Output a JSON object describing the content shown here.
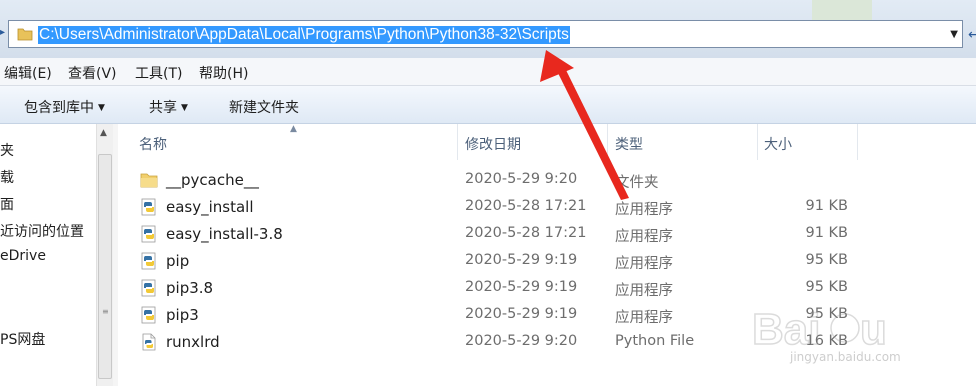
{
  "address": {
    "path": "C:\\Users\\Administrator\\AppData\\Local\\Programs\\Python\\Python38-32\\Scripts"
  },
  "menu": [
    {
      "label": "编辑(E)"
    },
    {
      "label": "查看(V)"
    },
    {
      "label": "工具(T)"
    },
    {
      "label": "帮助(H)"
    }
  ],
  "toolbar": {
    "include_library": "包含到库中",
    "share": "共享",
    "new_folder": "新建文件夹"
  },
  "nav": [
    {
      "label": "夹"
    },
    {
      "label": "载"
    },
    {
      "label": "面"
    },
    {
      "label": "近访问的位置"
    },
    {
      "label": "eDrive"
    },
    {
      "label": "PS网盘"
    }
  ],
  "columns": {
    "name": "名称",
    "date": "修改日期",
    "type": "类型",
    "size": "大小"
  },
  "files": [
    {
      "name": "__pycache__",
      "date": "2020-5-29 9:20",
      "type": "文件夹",
      "size": "",
      "icon": "folder-icon"
    },
    {
      "name": "easy_install",
      "date": "2020-5-28 17:21",
      "type": "应用程序",
      "size": "91 KB",
      "icon": "python-exe-icon"
    },
    {
      "name": "easy_install-3.8",
      "date": "2020-5-28 17:21",
      "type": "应用程序",
      "size": "91 KB",
      "icon": "python-exe-icon"
    },
    {
      "name": "pip",
      "date": "2020-5-29 9:19",
      "type": "应用程序",
      "size": "95 KB",
      "icon": "python-exe-icon"
    },
    {
      "name": "pip3.8",
      "date": "2020-5-29 9:19",
      "type": "应用程序",
      "size": "95 KB",
      "icon": "python-exe-icon"
    },
    {
      "name": "pip3",
      "date": "2020-5-29 9:19",
      "type": "应用程序",
      "size": "95 KB",
      "icon": "python-exe-icon"
    },
    {
      "name": "runxlrd",
      "date": "2020-5-29 9:20",
      "type": "Python File",
      "size": "16 KB",
      "icon": "python-file-icon"
    }
  ],
  "watermark": {
    "brand": "Baidu 经验",
    "url": "jingyan.baidu.com"
  },
  "colors": {
    "selection": "#3399ff",
    "annotation_arrow": "#e8281e",
    "header_text": "#4c607a"
  }
}
